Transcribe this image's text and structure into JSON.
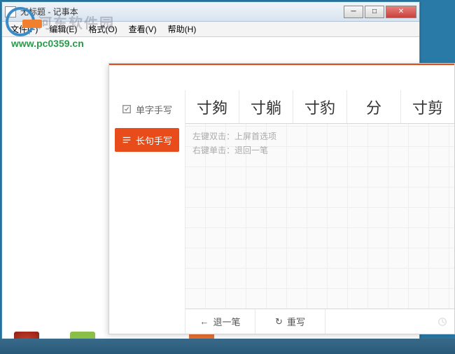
{
  "notepad": {
    "title": "无标题 - 记事本",
    "menu": {
      "file": "文件(F)",
      "edit": "编辑(E)",
      "format": "格式(O)",
      "view": "查看(V)",
      "help": "帮助(H)"
    }
  },
  "watermark": {
    "text": "河东软件园",
    "url": "www.pc0359.cn"
  },
  "ime": {
    "modes": {
      "single": "单字手写",
      "sentence": "长句手写"
    },
    "candidates": [
      "寸夠",
      "寸躺",
      "寸豹",
      "分",
      "寸剪"
    ],
    "hints": {
      "dblclick_label": "左键双击：",
      "dblclick_action": "上屏首选项",
      "rightclick_label": "右键单击：",
      "rightclick_action": "退回一笔"
    },
    "footer": {
      "undo": "退一笔",
      "rewrite": "重写"
    }
  }
}
